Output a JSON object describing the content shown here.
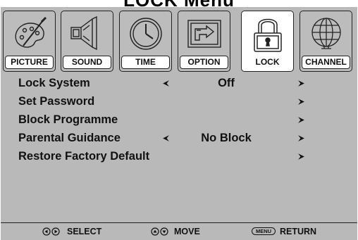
{
  "title": "LOCK Menu",
  "tabs": [
    {
      "label": "PICTURE",
      "icon": "picture-icon",
      "active": false
    },
    {
      "label": "SOUND",
      "icon": "speaker-icon",
      "active": false
    },
    {
      "label": "TIME",
      "icon": "clock-icon",
      "active": false
    },
    {
      "label": "OPTION",
      "icon": "option-icon",
      "active": false
    },
    {
      "label": "LOCK",
      "icon": "padlock-icon",
      "active": true
    },
    {
      "label": "CHANNEL",
      "icon": "globe-icon",
      "active": false
    }
  ],
  "menu": [
    {
      "label": "Lock System",
      "value": "Off",
      "left_arrow": true,
      "right_arrow": true
    },
    {
      "label": "Set Password",
      "value": "",
      "left_arrow": false,
      "right_arrow": true
    },
    {
      "label": "Block Programme",
      "value": "",
      "left_arrow": false,
      "right_arrow": true
    },
    {
      "label": "Parental Guidance",
      "value": "No Block",
      "left_arrow": true,
      "right_arrow": true
    },
    {
      "label": "Restore Factory Default",
      "value": "",
      "left_arrow": false,
      "right_arrow": true
    }
  ],
  "footer": {
    "select": "SELECT",
    "move": "MOVE",
    "menu_key": "MENU",
    "return": "RETURN"
  },
  "colors": {
    "panel": "#b9b9b9",
    "active_tab": "#ffffff",
    "text": "#111111"
  }
}
